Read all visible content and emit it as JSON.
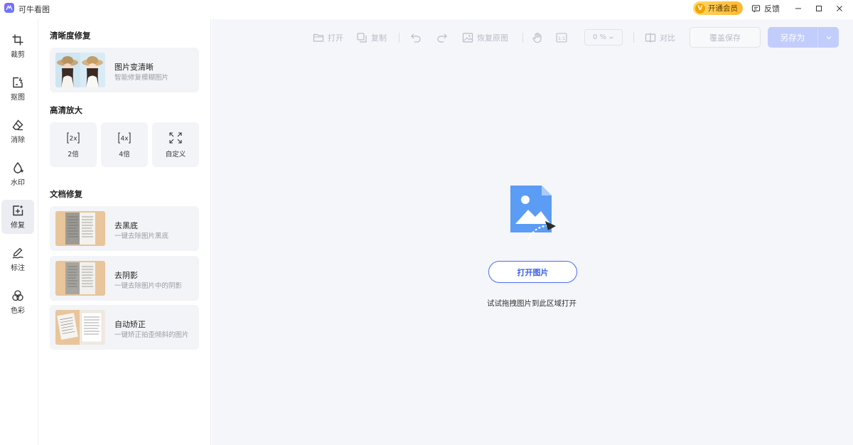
{
  "app": {
    "title": "可牛看图",
    "vip_label": "开通会员",
    "vip_badge": "V",
    "feedback_label": "反馈"
  },
  "window_controls": [
    "minimize",
    "maximize",
    "close"
  ],
  "rail": [
    {
      "label": "裁剪",
      "icon": "crop-icon",
      "active": false
    },
    {
      "label": "抠图",
      "icon": "cutout-icon",
      "active": false
    },
    {
      "label": "消除",
      "icon": "eraser-icon",
      "active": false
    },
    {
      "label": "水印",
      "icon": "watermark-icon",
      "active": false
    },
    {
      "label": "修复",
      "icon": "repair-icon",
      "active": true
    },
    {
      "label": "标注",
      "icon": "annotate-icon",
      "active": false
    },
    {
      "label": "色彩",
      "icon": "color-icon",
      "active": false
    }
  ],
  "panel": {
    "sections": {
      "clarity": "清晰度修复",
      "upscale": "高清放大",
      "document": "文档修复"
    },
    "clarity_card": {
      "title": "图片变清晰",
      "subtitle": "智能修复模糊图片"
    },
    "upscale": [
      {
        "label": "2倍",
        "icon": "2x-icon",
        "glyph": "2x"
      },
      {
        "label": "4倍",
        "icon": "4x-icon",
        "glyph": "4x"
      },
      {
        "label": "自定义",
        "icon": "expand-icon",
        "glyph": ""
      }
    ],
    "doc_cards": [
      {
        "title": "去黑底",
        "subtitle": "一键去除图片黑底"
      },
      {
        "title": "去阴影",
        "subtitle": "一键去除图片中的阴影"
      },
      {
        "title": "自动矫正",
        "subtitle": "一键矫正拍歪倾斜的图片"
      }
    ]
  },
  "toolbar": {
    "open": "打开",
    "copy": "复制",
    "restore": "恢复原图",
    "one_to_one": "1:1",
    "zoom_value": "0  %",
    "compare": "对比",
    "overwrite_save": "覆盖保存",
    "save_as": "另存为"
  },
  "workspace": {
    "open_image_button": "打开图片",
    "drop_hint": "试试拖拽图片到此区域打开"
  },
  "colors": {
    "accent": "#4a6cf7",
    "save_as_bg": "#c3cdfc",
    "workspace_bg": "#f5f6fa",
    "icon_blue": "#5b9cf5",
    "vip_gold": "#ffb72e"
  }
}
